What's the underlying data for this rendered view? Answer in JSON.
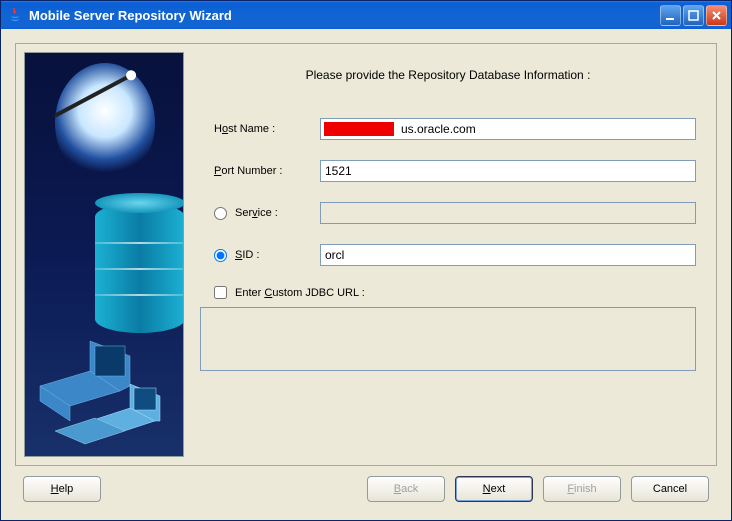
{
  "window": {
    "title": "Mobile Server Repository Wizard"
  },
  "heading": "Please provide the Repository Database Information :",
  "form": {
    "host": {
      "label_pre": "H",
      "label_u": "o",
      "label_post": "st Name :",
      "value": "us.oracle.com"
    },
    "port": {
      "label_u": "P",
      "label_post": "ort Number :",
      "value": "1521"
    },
    "service": {
      "label_pre": "Ser",
      "label_u": "v",
      "label_post": "ice :",
      "value": "",
      "selected": false
    },
    "sid": {
      "label_u": "S",
      "label_post": "ID :",
      "value": "orcl",
      "selected": true
    },
    "custom": {
      "label_pre": "Enter ",
      "label_u": "C",
      "label_post": "ustom JDBC URL :",
      "checked": false,
      "value": ""
    }
  },
  "buttons": {
    "help_u": "H",
    "help_post": "elp",
    "back_u": "B",
    "back_post": "ack",
    "next_u": "N",
    "next_post": "ext",
    "finish_u": "F",
    "finish_post": "inish",
    "cancel": "Cancel"
  }
}
